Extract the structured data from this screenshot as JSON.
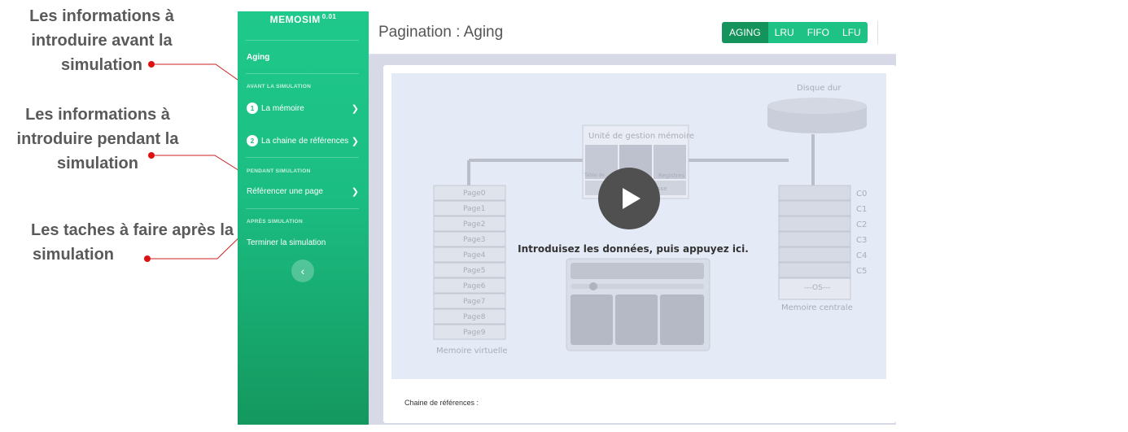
{
  "annotations": {
    "before": [
      "Les informations à",
      "introduire avant la",
      "simulation"
    ],
    "during": [
      "Les informations à",
      "introduire pendant la",
      "simulation"
    ],
    "after": [
      "Les taches à faire après la",
      "simulation"
    ]
  },
  "sidebar": {
    "brand": "MEMOSIM",
    "version": "0.01",
    "current": "Aging",
    "section_before": "AVANT LA SIMULATION",
    "item_memory": {
      "num": "1",
      "label": "La mémoire"
    },
    "item_chain": {
      "num": "2",
      "label": "La chaine de références"
    },
    "section_during": "PENDANT SIMULATION",
    "item_reference": "Référencer une page",
    "section_after": "APRÈS SIMULATION",
    "item_finish": "Terminer la simulation",
    "collapse_icon": "chevron-left-icon"
  },
  "header": {
    "title": "Pagination : Aging",
    "algorithms": [
      "AGING",
      "LRU",
      "FIFO",
      "LFU"
    ],
    "active_algorithm": "AGING"
  },
  "simulation": {
    "disk_label": "Disque dur",
    "mmu_label": "Unité de gestion mémoire",
    "mmu_parts": [
      "Table de ...",
      "Registres",
      "... d'adresse"
    ],
    "virtual_pages": [
      "Page0",
      "Page1",
      "Page2",
      "Page3",
      "Page4",
      "Page5",
      "Page6",
      "Page7",
      "Page8",
      "Page9"
    ],
    "virtual_label": "Memoire virtuelle",
    "frames": [
      "C0",
      "C1",
      "C2",
      "C3",
      "C4",
      "C5"
    ],
    "os_label": "---OS---",
    "central_label": "Memoire centrale",
    "intro": "Introduisez les données, puis appuyez ici."
  },
  "footer": {
    "chain_label": "Chaine de références :"
  },
  "colors": {
    "sidebar": "#1fc98b",
    "accent_active": "#14935c",
    "accent": "#1ec285",
    "annotation_line": "#cc1f1f"
  }
}
